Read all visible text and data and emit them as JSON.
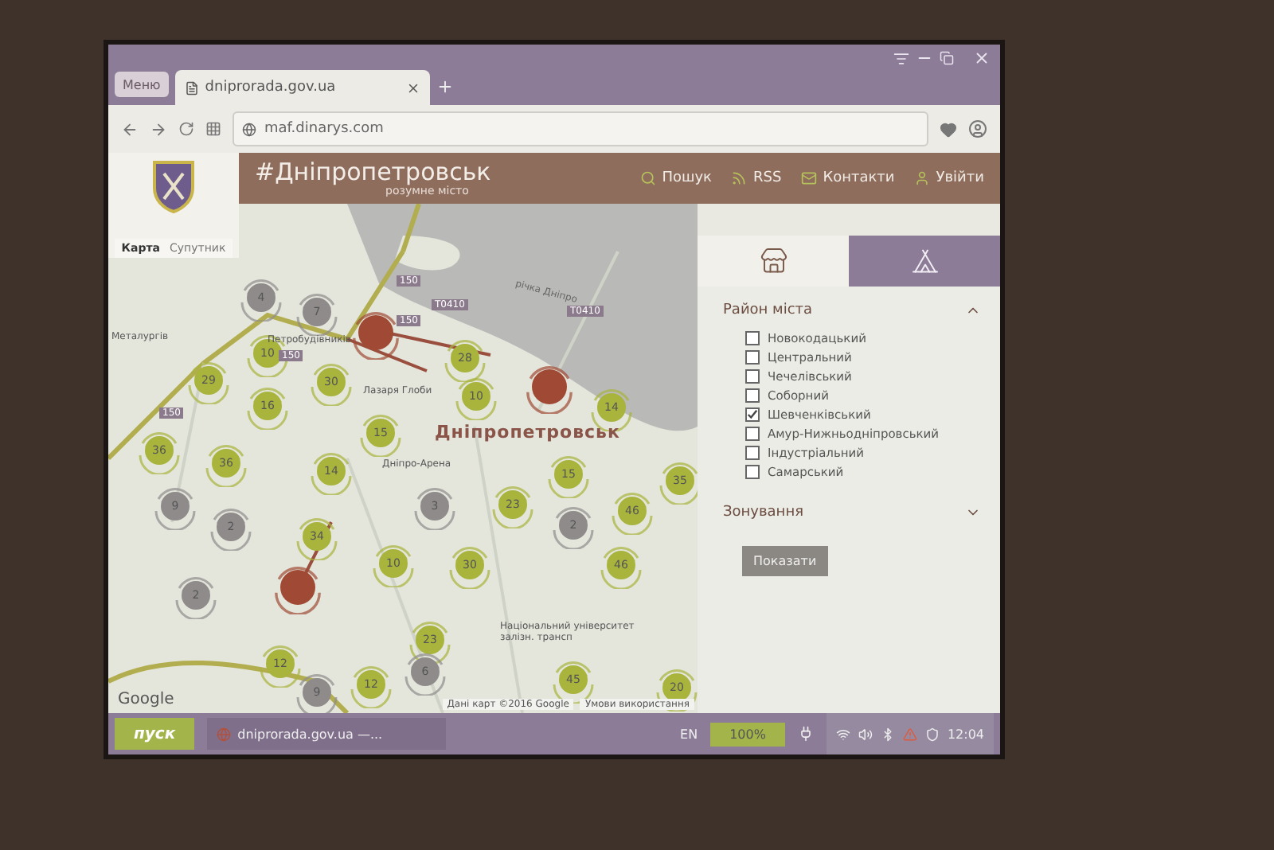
{
  "browser": {
    "menu_label": "Меню",
    "tab": {
      "title": "dniprorada.gov.ua"
    },
    "url": "maf.dinarys.com"
  },
  "site": {
    "title": "#Дніпропетровськ",
    "subtitle": "розумне місто",
    "nav": [
      {
        "label": "Пошук",
        "kind": "search"
      },
      {
        "label": "RSS",
        "kind": "rss"
      },
      {
        "label": "Контакти",
        "kind": "mail"
      },
      {
        "label": "Увійти",
        "kind": "user"
      }
    ]
  },
  "map": {
    "types": [
      {
        "label": "Карта",
        "selected": true
      },
      {
        "label": "Супутник",
        "selected": false
      }
    ],
    "labels": [
      {
        "text": "Металургів",
        "kind": "place"
      },
      {
        "text": "Петробудівників",
        "kind": "place"
      },
      {
        "text": "Лазаря Глоби",
        "kind": "place"
      },
      {
        "text": "річка Дніпро",
        "kind": "water"
      },
      {
        "text": "Дніпропетровськ",
        "kind": "city"
      },
      {
        "text": "Дніпро-Арена",
        "kind": "place"
      },
      {
        "text": "Національний університет залізн. трансп",
        "kind": "place"
      },
      {
        "text": "Т0410",
        "kind": "road"
      },
      {
        "text": "Т0410",
        "kind": "road"
      },
      {
        "text": "150",
        "kind": "road"
      },
      {
        "text": "150",
        "kind": "road"
      },
      {
        "text": "150",
        "kind": "road"
      },
      {
        "text": "150",
        "kind": "road"
      }
    ],
    "markers": [
      {
        "label": "4",
        "color": "#8f8b8b"
      },
      {
        "label": "7",
        "color": "#8f8b8b"
      },
      {
        "color": "#a04a35"
      },
      {
        "label": "10",
        "color": "#a8b43c"
      },
      {
        "label": "29",
        "color": "#a8b43c"
      },
      {
        "label": "30",
        "color": "#a8b43c"
      },
      {
        "label": "28",
        "color": "#a8b43c"
      },
      {
        "label": "16",
        "color": "#a8b43c"
      },
      {
        "label": "15",
        "color": "#a8b43c"
      },
      {
        "label": "10",
        "color": "#a8b43c"
      },
      {
        "color": "#a04a35"
      },
      {
        "label": "14",
        "color": "#a8b43c"
      },
      {
        "label": "36",
        "color": "#a8b43c"
      },
      {
        "label": "36",
        "color": "#a8b43c"
      },
      {
        "label": "14",
        "color": "#a8b43c"
      },
      {
        "label": "15",
        "color": "#a8b43c"
      },
      {
        "label": "35",
        "color": "#a8b43c"
      },
      {
        "label": "9",
        "color": "#8f8b8b"
      },
      {
        "label": "2",
        "color": "#8f8b8b"
      },
      {
        "label": "3",
        "color": "#8f8b8b"
      },
      {
        "label": "23",
        "color": "#a8b43c"
      },
      {
        "label": "46",
        "color": "#a8b43c"
      },
      {
        "label": "2",
        "color": "#8f8b8b"
      },
      {
        "label": "34",
        "color": "#a8b43c"
      },
      {
        "label": "10",
        "color": "#a8b43c"
      },
      {
        "label": "30",
        "color": "#a8b43c"
      },
      {
        "label": "46",
        "color": "#a8b43c"
      },
      {
        "color": "#a04a35"
      },
      {
        "label": "2",
        "color": "#8f8b8b"
      },
      {
        "label": "23",
        "color": "#a8b43c"
      },
      {
        "label": "12",
        "color": "#a8b43c"
      },
      {
        "label": "9",
        "color": "#8f8b8b"
      },
      {
        "label": "12",
        "color": "#a8b43c"
      },
      {
        "label": "6",
        "color": "#8f8b8b"
      },
      {
        "label": "45",
        "color": "#a8b43c"
      },
      {
        "label": "20",
        "color": "#a8b43c"
      }
    ],
    "logo": "Google",
    "attribution": "Дані карт ©2016 Google",
    "terms": "Умови використання"
  },
  "panel": {
    "tabs": [
      {
        "kind": "shop",
        "selected": false
      },
      {
        "kind": "tent",
        "selected": true
      }
    ],
    "sections": [
      {
        "title": "Район міста",
        "expanded": true,
        "options": [
          {
            "label": "Новокодацький",
            "checked": false
          },
          {
            "label": "Центральний",
            "checked": false
          },
          {
            "label": "Чечелівський",
            "checked": false
          },
          {
            "label": "Соборний",
            "checked": false
          },
          {
            "label": "Шевченківський",
            "checked": true
          },
          {
            "label": "Амур-Нижньодніпровський",
            "checked": false
          },
          {
            "label": "Індустріальний",
            "checked": false
          },
          {
            "label": "Самарський",
            "checked": false
          }
        ]
      },
      {
        "title": "Зонування",
        "expanded": false
      }
    ],
    "button": "Показати"
  },
  "taskbar": {
    "start": "пуск",
    "task": "dniprorada.gov.ua —...",
    "language": "EN",
    "battery": "100%",
    "time": "12:04"
  }
}
